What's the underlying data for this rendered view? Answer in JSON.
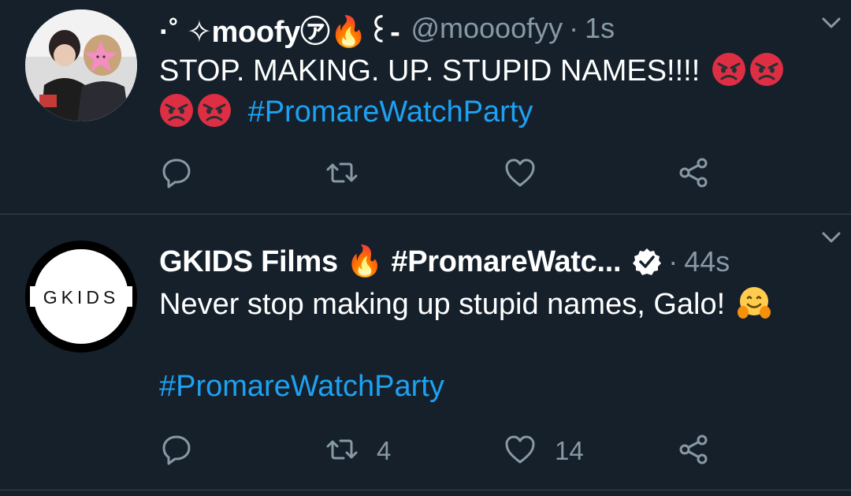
{
  "tweets": [
    {
      "author_name": "·˚ ✧moofy㋐🔥꒰-",
      "handle": "@moooofyy",
      "separator": "·",
      "time": "1s",
      "text_plain": "STOP. MAKING. UP. STUPID NAMES!!!! ",
      "emoji_line1": [
        "angry-face",
        "angry-face"
      ],
      "emoji_line2": [
        "angry-face",
        "angry-face"
      ],
      "hashtag": "#PromareWatchParty",
      "counts": {
        "reply": "",
        "retweet": "",
        "like": ""
      }
    },
    {
      "author_name": "GKIDS Films 🔥 #PromareWatc...",
      "avatar_text": "GKIDS",
      "verified": true,
      "separator": "·",
      "time": "44s",
      "text_plain": "Never stop making up stupid names, Galo! ",
      "emoji": "hugging-face",
      "hashtag": "#PromareWatchParty",
      "counts": {
        "reply": "",
        "retweet": "4",
        "like": "14"
      }
    }
  ],
  "colors": {
    "background": "#15202b",
    "divider": "#38444d",
    "secondary_text": "#8899a6",
    "link": "#1da1f2"
  }
}
